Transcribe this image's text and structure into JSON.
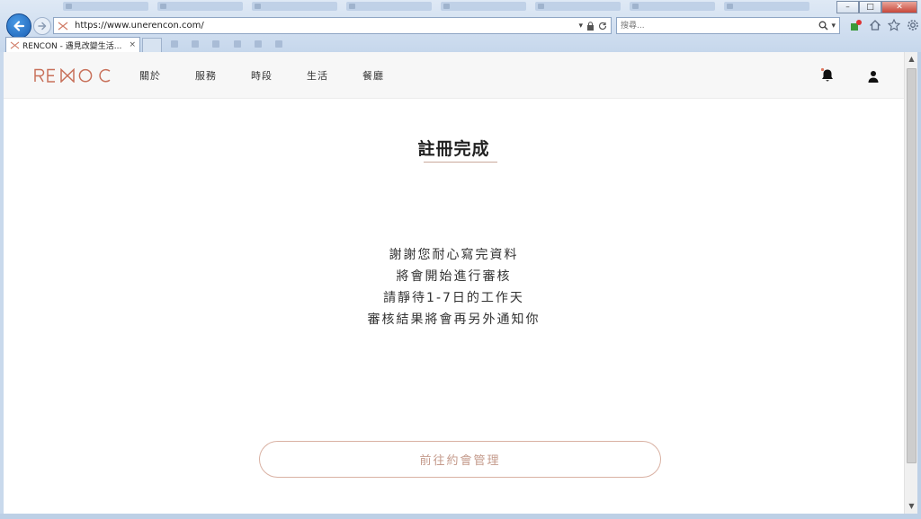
{
  "browser": {
    "url": "https://www.unerencon.com/",
    "search_placeholder": "搜尋...",
    "tab_title": "RENCON - 遇見改變生活...",
    "tab_close": "×",
    "window_controls": {
      "minimize": "–",
      "maximize": "□",
      "close": "✕"
    }
  },
  "site": {
    "logo_text": "RENCON",
    "nav": [
      {
        "label": "關於"
      },
      {
        "label": "服務"
      },
      {
        "label": "時段"
      },
      {
        "label": "生活"
      },
      {
        "label": "餐廳"
      }
    ]
  },
  "content": {
    "title": "註冊完成",
    "message_lines": [
      "謝謝您耐心寫完資料",
      "將會開始進行審核",
      "請靜待1-7日的工作天",
      "審核結果將會再另外通知你"
    ],
    "cta_label": "前往約會管理"
  },
  "colors": {
    "accent": "#c49a8b",
    "logo": "#c8705a",
    "browser_blue": "#1b5fb4"
  },
  "icons": [
    "back-arrow-icon",
    "forward-arrow-icon",
    "site-favicon-icon",
    "lock-icon",
    "refresh-icon",
    "search-icon",
    "home-icon",
    "star-icon",
    "gear-icon",
    "bell-icon",
    "user-icon"
  ]
}
